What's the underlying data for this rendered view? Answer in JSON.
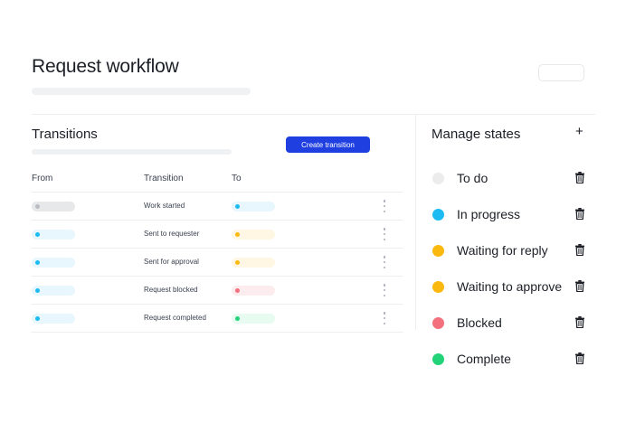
{
  "colors": {
    "accent": "#1f3fe0",
    "gray": "#e7e8ea",
    "gray_dot": "#b9bcc2",
    "blue": "#1cbcf3",
    "blue_bg": "#e8f7fd",
    "yellow": "#fbb80f",
    "yellow_bg": "#fff6e3",
    "red": "#f3707e",
    "red_bg": "#fdeced",
    "green": "#22d37a",
    "green_bg": "#e7fbf0"
  },
  "header": {
    "title": "Request workflow"
  },
  "transitions": {
    "title": "Transitions",
    "create_button": "Create transition",
    "columns": {
      "from": "From",
      "transition": "Transition",
      "to": "To"
    },
    "rows": [
      {
        "from": "gray",
        "label": "Work started",
        "to": "blue"
      },
      {
        "from": "blue",
        "label": "Sent to requester",
        "to": "yellow"
      },
      {
        "from": "blue",
        "label": "Sent for approval",
        "to": "yellow"
      },
      {
        "from": "blue",
        "label": "Request blocked",
        "to": "red"
      },
      {
        "from": "blue",
        "label": "Request completed",
        "to": "green"
      }
    ]
  },
  "manage_states": {
    "title": "Manage states",
    "add_icon": "plus-icon",
    "states": [
      {
        "label": "To do",
        "color": "#ececed"
      },
      {
        "label": "In progress",
        "color": "#1cbcf3"
      },
      {
        "label": "Waiting for reply",
        "color": "#fbb80f"
      },
      {
        "label": "Waiting to approve",
        "color": "#fbb80f"
      },
      {
        "label": "Blocked",
        "color": "#f3707e"
      },
      {
        "label": "Complete",
        "color": "#22d37a"
      }
    ]
  }
}
